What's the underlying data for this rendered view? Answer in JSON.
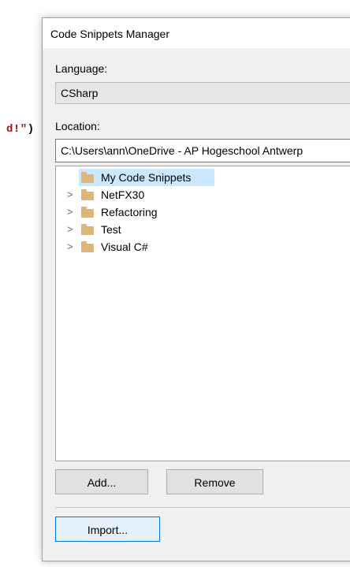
{
  "editor": {
    "code_text": "d!\"",
    "code_paren": ")"
  },
  "dialog": {
    "title": "Code Snippets Manager",
    "language_label": "Language:",
    "language_value": "CSharp",
    "location_label": "Location:",
    "location_value": "C:\\Users\\ann\\OneDrive - AP Hogeschool Antwerp",
    "tree": [
      {
        "label": "My Code Snippets",
        "expandable": false,
        "selected": true,
        "icon": "folder-icon"
      },
      {
        "label": "NetFX30",
        "expandable": true,
        "selected": false,
        "icon": "folder-icon"
      },
      {
        "label": "Refactoring",
        "expandable": true,
        "selected": false,
        "icon": "folder-icon"
      },
      {
        "label": "Test",
        "expandable": true,
        "selected": false,
        "icon": "folder-icon"
      },
      {
        "label": "Visual C#",
        "expandable": true,
        "selected": false,
        "icon": "folder-icon"
      }
    ],
    "chevron_glyph": ">",
    "dropdown_glyph": "⌄",
    "buttons": {
      "add": "Add...",
      "remove": "Remove",
      "import": "Import..."
    },
    "colors": {
      "selected_row": "#cce8ff",
      "folder": "#dcb67a",
      "import_border": "#0078d7"
    }
  }
}
